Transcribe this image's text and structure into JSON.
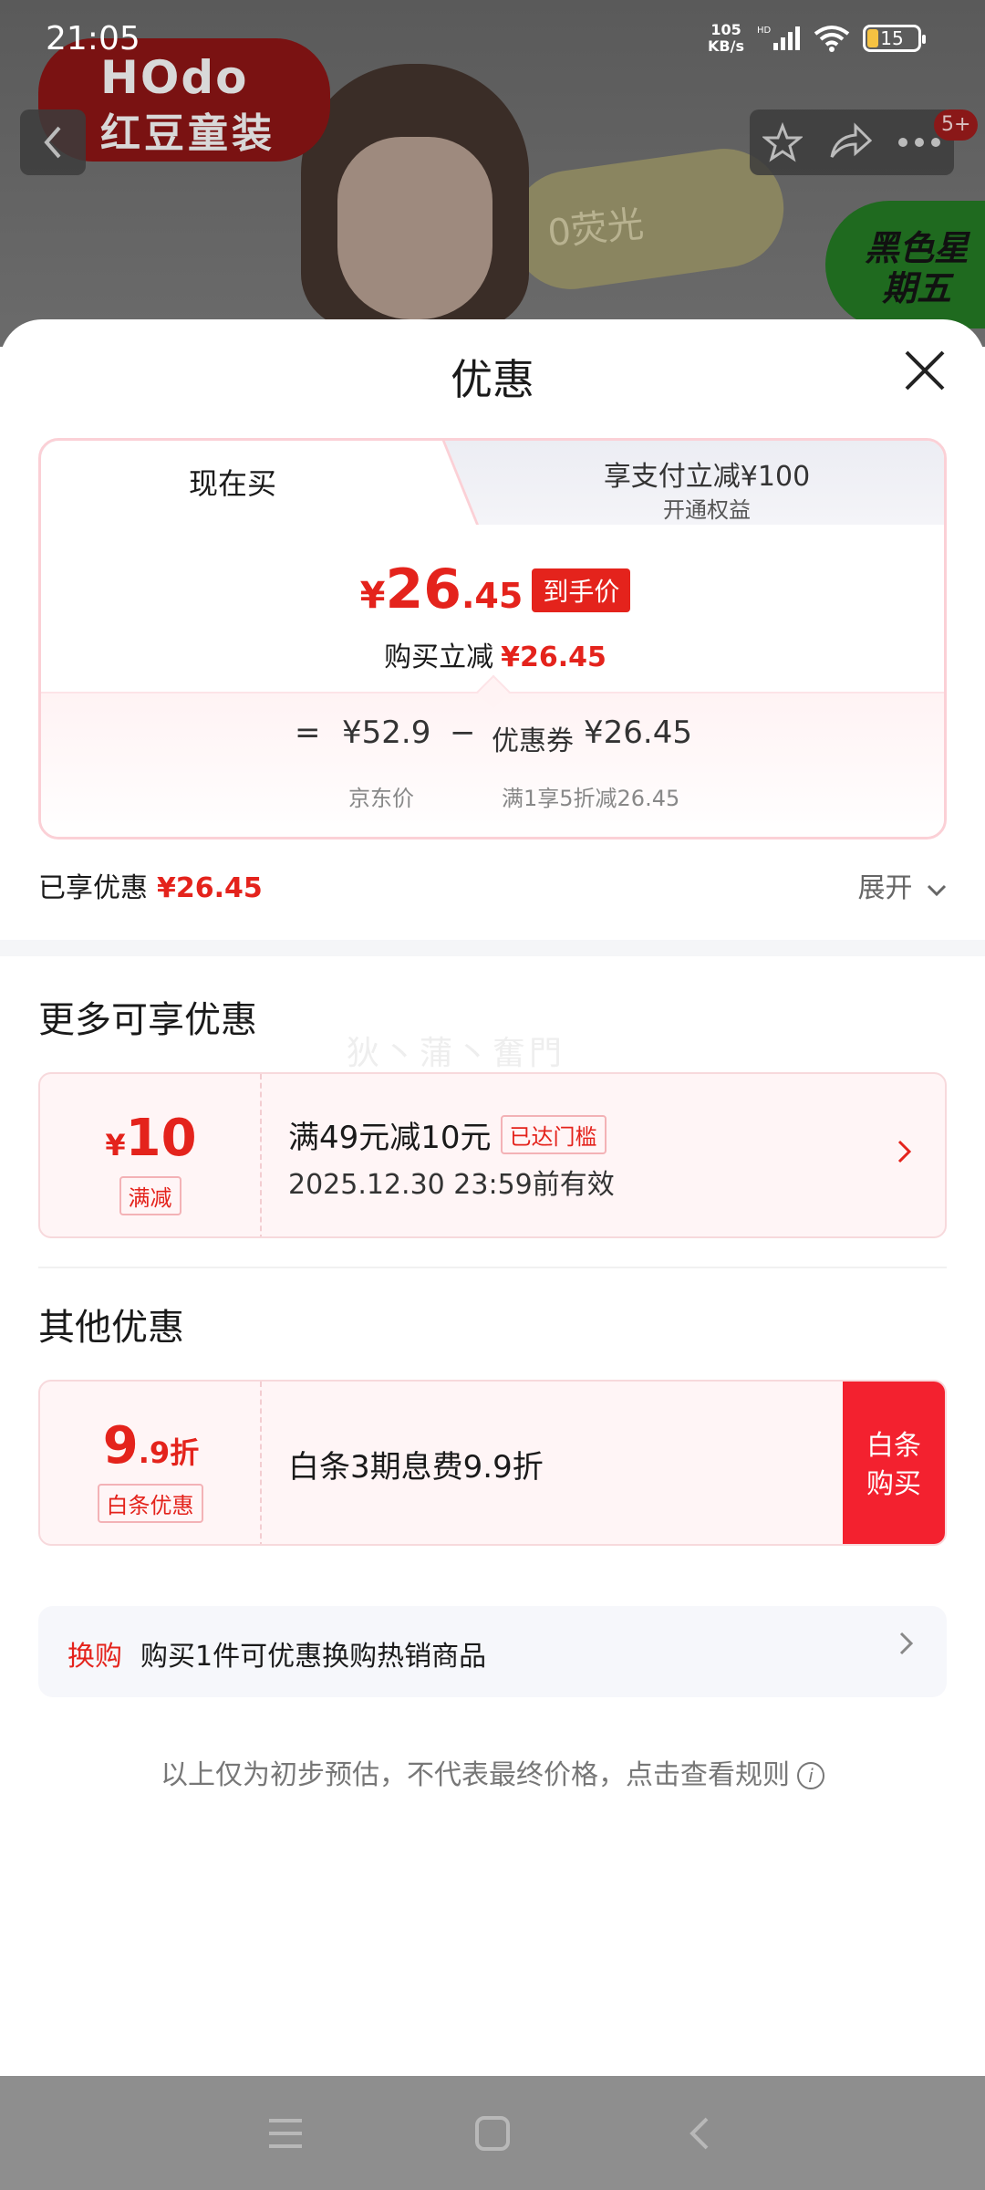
{
  "status_bar": {
    "time": "21:05",
    "net_speed_value": "105",
    "net_speed_unit": "KB/s",
    "hd_label": "HD",
    "battery": "15"
  },
  "background": {
    "brand_top": "HOdo",
    "brand_bottom": "红豆童装",
    "blob_text": "0荧光",
    "promo_text": "黑色星期五",
    "message_badge": "5+"
  },
  "sheet": {
    "title": "优惠"
  },
  "tabs": {
    "buy_now": "现在买",
    "pay_title": "享支付立减¥100",
    "pay_sub": "开通权益"
  },
  "price": {
    "yen": "¥",
    "final_int": "26",
    "final_dec": ".45",
    "final_tag": "到手价",
    "instant_label": "购买立减",
    "instant_amount": "¥26.45"
  },
  "formula": {
    "eq": "=",
    "jd_price": "¥52.9",
    "minus": "−",
    "coupon_label": "优惠券",
    "coupon_value": "¥26.45",
    "jd_label": "京东价",
    "coupon_desc": "满1享5折减26.45"
  },
  "enjoyed": {
    "label": "已享优惠",
    "amount": "¥26.45",
    "expand": "展开"
  },
  "more_section": {
    "title": "更多可享优惠",
    "watermark": "狄丶蒲丶奮門",
    "coupon": {
      "yen": "¥",
      "amount": "10",
      "tag": "满减",
      "title": "满49元减10元",
      "reach_tag": "已达门槛",
      "validity": "2025.12.30 23:59前有效"
    }
  },
  "other_section": {
    "title": "其他优惠",
    "baitiao": {
      "amount_int": "9",
      "amount_dec": ".9折",
      "tag": "白条优惠",
      "desc": "白条3期息费9.9折",
      "action_line1": "白条",
      "action_line2": "购买"
    }
  },
  "swap": {
    "label": "换购",
    "text": "购买1件可优惠换购热销商品"
  },
  "disclaimer": "以上仅为初步预估，不代表最终价格，点击查看规则",
  "icons": {
    "back": "back-arrow-icon",
    "star": "star-icon",
    "share": "share-icon",
    "more": "more-icon",
    "close": "close-icon",
    "chevron": "chevron-right-icon",
    "info": "info-icon",
    "menu": "menu-icon",
    "home": "home-icon",
    "nav_back": "nav-back-icon"
  },
  "colors": {
    "accent_red": "#e4231c",
    "action_red": "#f3212f",
    "card_border": "#fbd0d6"
  }
}
